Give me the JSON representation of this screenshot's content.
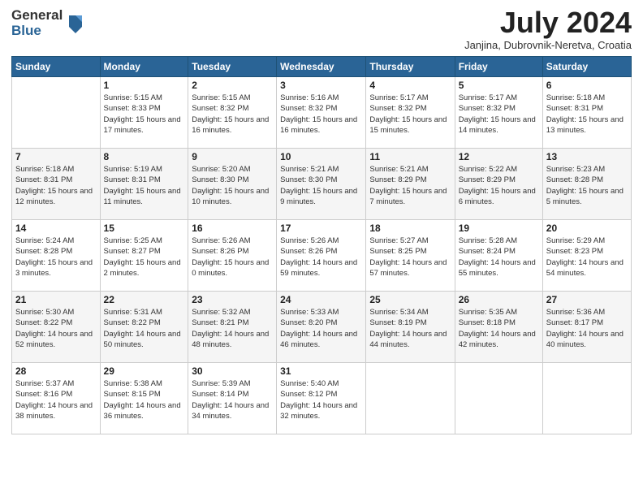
{
  "logo": {
    "general": "General",
    "blue": "Blue"
  },
  "title": "July 2024",
  "location": "Janjina, Dubrovnik-Neretva, Croatia",
  "weekdays": [
    "Sunday",
    "Monday",
    "Tuesday",
    "Wednesday",
    "Thursday",
    "Friday",
    "Saturday"
  ],
  "weeks": [
    [
      {
        "day": "",
        "sunrise": "",
        "sunset": "",
        "daylight": ""
      },
      {
        "day": "1",
        "sunrise": "Sunrise: 5:15 AM",
        "sunset": "Sunset: 8:33 PM",
        "daylight": "Daylight: 15 hours and 17 minutes."
      },
      {
        "day": "2",
        "sunrise": "Sunrise: 5:15 AM",
        "sunset": "Sunset: 8:32 PM",
        "daylight": "Daylight: 15 hours and 16 minutes."
      },
      {
        "day": "3",
        "sunrise": "Sunrise: 5:16 AM",
        "sunset": "Sunset: 8:32 PM",
        "daylight": "Daylight: 15 hours and 16 minutes."
      },
      {
        "day": "4",
        "sunrise": "Sunrise: 5:17 AM",
        "sunset": "Sunset: 8:32 PM",
        "daylight": "Daylight: 15 hours and 15 minutes."
      },
      {
        "day": "5",
        "sunrise": "Sunrise: 5:17 AM",
        "sunset": "Sunset: 8:32 PM",
        "daylight": "Daylight: 15 hours and 14 minutes."
      },
      {
        "day": "6",
        "sunrise": "Sunrise: 5:18 AM",
        "sunset": "Sunset: 8:31 PM",
        "daylight": "Daylight: 15 hours and 13 minutes."
      }
    ],
    [
      {
        "day": "7",
        "sunrise": "Sunrise: 5:18 AM",
        "sunset": "Sunset: 8:31 PM",
        "daylight": "Daylight: 15 hours and 12 minutes."
      },
      {
        "day": "8",
        "sunrise": "Sunrise: 5:19 AM",
        "sunset": "Sunset: 8:31 PM",
        "daylight": "Daylight: 15 hours and 11 minutes."
      },
      {
        "day": "9",
        "sunrise": "Sunrise: 5:20 AM",
        "sunset": "Sunset: 8:30 PM",
        "daylight": "Daylight: 15 hours and 10 minutes."
      },
      {
        "day": "10",
        "sunrise": "Sunrise: 5:21 AM",
        "sunset": "Sunset: 8:30 PM",
        "daylight": "Daylight: 15 hours and 9 minutes."
      },
      {
        "day": "11",
        "sunrise": "Sunrise: 5:21 AM",
        "sunset": "Sunset: 8:29 PM",
        "daylight": "Daylight: 15 hours and 7 minutes."
      },
      {
        "day": "12",
        "sunrise": "Sunrise: 5:22 AM",
        "sunset": "Sunset: 8:29 PM",
        "daylight": "Daylight: 15 hours and 6 minutes."
      },
      {
        "day": "13",
        "sunrise": "Sunrise: 5:23 AM",
        "sunset": "Sunset: 8:28 PM",
        "daylight": "Daylight: 15 hours and 5 minutes."
      }
    ],
    [
      {
        "day": "14",
        "sunrise": "Sunrise: 5:24 AM",
        "sunset": "Sunset: 8:28 PM",
        "daylight": "Daylight: 15 hours and 3 minutes."
      },
      {
        "day": "15",
        "sunrise": "Sunrise: 5:25 AM",
        "sunset": "Sunset: 8:27 PM",
        "daylight": "Daylight: 15 hours and 2 minutes."
      },
      {
        "day": "16",
        "sunrise": "Sunrise: 5:26 AM",
        "sunset": "Sunset: 8:26 PM",
        "daylight": "Daylight: 15 hours and 0 minutes."
      },
      {
        "day": "17",
        "sunrise": "Sunrise: 5:26 AM",
        "sunset": "Sunset: 8:26 PM",
        "daylight": "Daylight: 14 hours and 59 minutes."
      },
      {
        "day": "18",
        "sunrise": "Sunrise: 5:27 AM",
        "sunset": "Sunset: 8:25 PM",
        "daylight": "Daylight: 14 hours and 57 minutes."
      },
      {
        "day": "19",
        "sunrise": "Sunrise: 5:28 AM",
        "sunset": "Sunset: 8:24 PM",
        "daylight": "Daylight: 14 hours and 55 minutes."
      },
      {
        "day": "20",
        "sunrise": "Sunrise: 5:29 AM",
        "sunset": "Sunset: 8:23 PM",
        "daylight": "Daylight: 14 hours and 54 minutes."
      }
    ],
    [
      {
        "day": "21",
        "sunrise": "Sunrise: 5:30 AM",
        "sunset": "Sunset: 8:22 PM",
        "daylight": "Daylight: 14 hours and 52 minutes."
      },
      {
        "day": "22",
        "sunrise": "Sunrise: 5:31 AM",
        "sunset": "Sunset: 8:22 PM",
        "daylight": "Daylight: 14 hours and 50 minutes."
      },
      {
        "day": "23",
        "sunrise": "Sunrise: 5:32 AM",
        "sunset": "Sunset: 8:21 PM",
        "daylight": "Daylight: 14 hours and 48 minutes."
      },
      {
        "day": "24",
        "sunrise": "Sunrise: 5:33 AM",
        "sunset": "Sunset: 8:20 PM",
        "daylight": "Daylight: 14 hours and 46 minutes."
      },
      {
        "day": "25",
        "sunrise": "Sunrise: 5:34 AM",
        "sunset": "Sunset: 8:19 PM",
        "daylight": "Daylight: 14 hours and 44 minutes."
      },
      {
        "day": "26",
        "sunrise": "Sunrise: 5:35 AM",
        "sunset": "Sunset: 8:18 PM",
        "daylight": "Daylight: 14 hours and 42 minutes."
      },
      {
        "day": "27",
        "sunrise": "Sunrise: 5:36 AM",
        "sunset": "Sunset: 8:17 PM",
        "daylight": "Daylight: 14 hours and 40 minutes."
      }
    ],
    [
      {
        "day": "28",
        "sunrise": "Sunrise: 5:37 AM",
        "sunset": "Sunset: 8:16 PM",
        "daylight": "Daylight: 14 hours and 38 minutes."
      },
      {
        "day": "29",
        "sunrise": "Sunrise: 5:38 AM",
        "sunset": "Sunset: 8:15 PM",
        "daylight": "Daylight: 14 hours and 36 minutes."
      },
      {
        "day": "30",
        "sunrise": "Sunrise: 5:39 AM",
        "sunset": "Sunset: 8:14 PM",
        "daylight": "Daylight: 14 hours and 34 minutes."
      },
      {
        "day": "31",
        "sunrise": "Sunrise: 5:40 AM",
        "sunset": "Sunset: 8:12 PM",
        "daylight": "Daylight: 14 hours and 32 minutes."
      },
      {
        "day": "",
        "sunrise": "",
        "sunset": "",
        "daylight": ""
      },
      {
        "day": "",
        "sunrise": "",
        "sunset": "",
        "daylight": ""
      },
      {
        "day": "",
        "sunrise": "",
        "sunset": "",
        "daylight": ""
      }
    ]
  ]
}
